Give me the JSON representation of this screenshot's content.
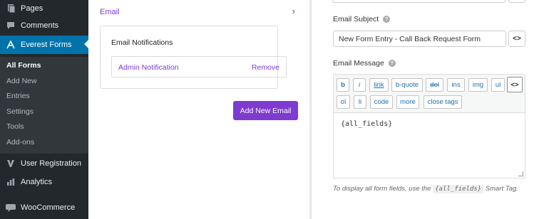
{
  "sidebar": {
    "items": [
      {
        "label": "Pages",
        "icon": "pages-icon"
      },
      {
        "label": "Comments",
        "icon": "comments-icon"
      },
      {
        "label": "Everest Forms",
        "icon": "everest-forms-icon"
      },
      {
        "label": "User Registration",
        "icon": "user-registration-icon"
      },
      {
        "label": "Analytics",
        "icon": "analytics-icon"
      },
      {
        "label": "WooCommerce",
        "icon": "woocommerce-icon"
      }
    ],
    "submenu": [
      "All Forms",
      "Add New",
      "Entries",
      "Settings",
      "Tools",
      "Add-ons"
    ],
    "current_sub": "All Forms",
    "accent_color": "#0073aa"
  },
  "middle": {
    "section_label": "Email",
    "notifications_title": "Email Notifications",
    "notification_name": "Admin Notification",
    "remove_label": "Remove",
    "add_button": "Add New Email",
    "brand_color": "#7e3bd0"
  },
  "right": {
    "subject_label": "Email Subject",
    "subject_value": "New Form Entry  - Call Back Request Form",
    "message_label": "Email Message",
    "toolbar": [
      "b",
      "i",
      "link",
      "b-quote",
      "del",
      "ins",
      "img",
      "ul",
      "ol",
      "li",
      "code",
      "more",
      "close tags"
    ],
    "message_value": "{all_fields}",
    "hint_prefix": "To display all form fields, use the",
    "hint_code": "{all_fields}",
    "hint_suffix": "Smart Tag."
  }
}
